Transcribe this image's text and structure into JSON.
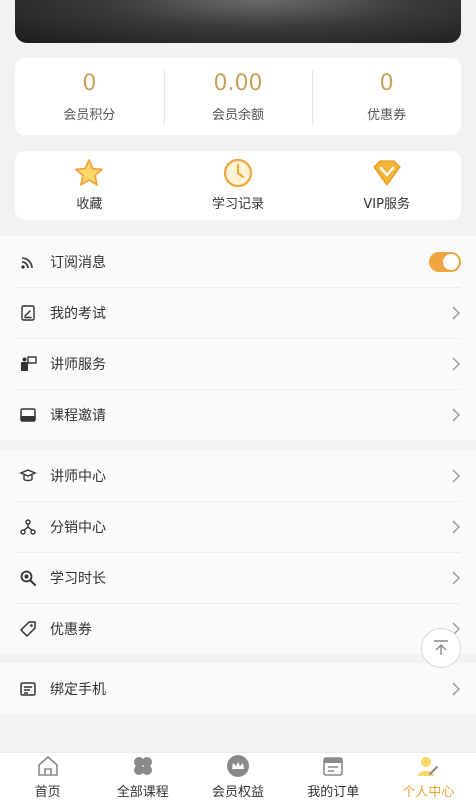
{
  "stats": [
    {
      "value": "0",
      "label": "会员积分"
    },
    {
      "value": "0.00",
      "label": "会员余额"
    },
    {
      "value": "0",
      "label": "优惠券"
    }
  ],
  "quick_links": [
    {
      "label": "收藏",
      "icon": "star-icon"
    },
    {
      "label": "学习记录",
      "icon": "clock-icon"
    },
    {
      "label": "VIP服务",
      "icon": "vip-diamond-icon"
    }
  ],
  "menu_group_1": [
    {
      "label": "订阅消息",
      "icon": "rss-icon",
      "toggle": true
    },
    {
      "label": "我的考试",
      "icon": "exam-icon"
    },
    {
      "label": "讲师服务",
      "icon": "lecturer-service-icon"
    },
    {
      "label": "课程邀请",
      "icon": "inbox-icon"
    }
  ],
  "menu_group_2": [
    {
      "label": "讲师中心",
      "icon": "graduation-cap-icon"
    },
    {
      "label": "分销中心",
      "icon": "network-icon"
    },
    {
      "label": "学习时长",
      "icon": "magnifier-icon"
    },
    {
      "label": "优惠券",
      "icon": "coupon-tag-icon"
    }
  ],
  "menu_group_3": [
    {
      "label": "绑定手机",
      "icon": "phone-card-icon"
    }
  ],
  "tabbar": [
    {
      "label": "首页",
      "icon": "home-icon"
    },
    {
      "label": "全部课程",
      "icon": "clover-icon"
    },
    {
      "label": "会员权益",
      "icon": "crown-icon"
    },
    {
      "label": "我的订单",
      "icon": "calendar-icon"
    },
    {
      "label": "个人中心",
      "icon": "user-icon",
      "active": true
    }
  ],
  "colors": {
    "accent": "#e8a135",
    "stat_value": "#caa05a",
    "toggle_on": "#f0a640"
  }
}
